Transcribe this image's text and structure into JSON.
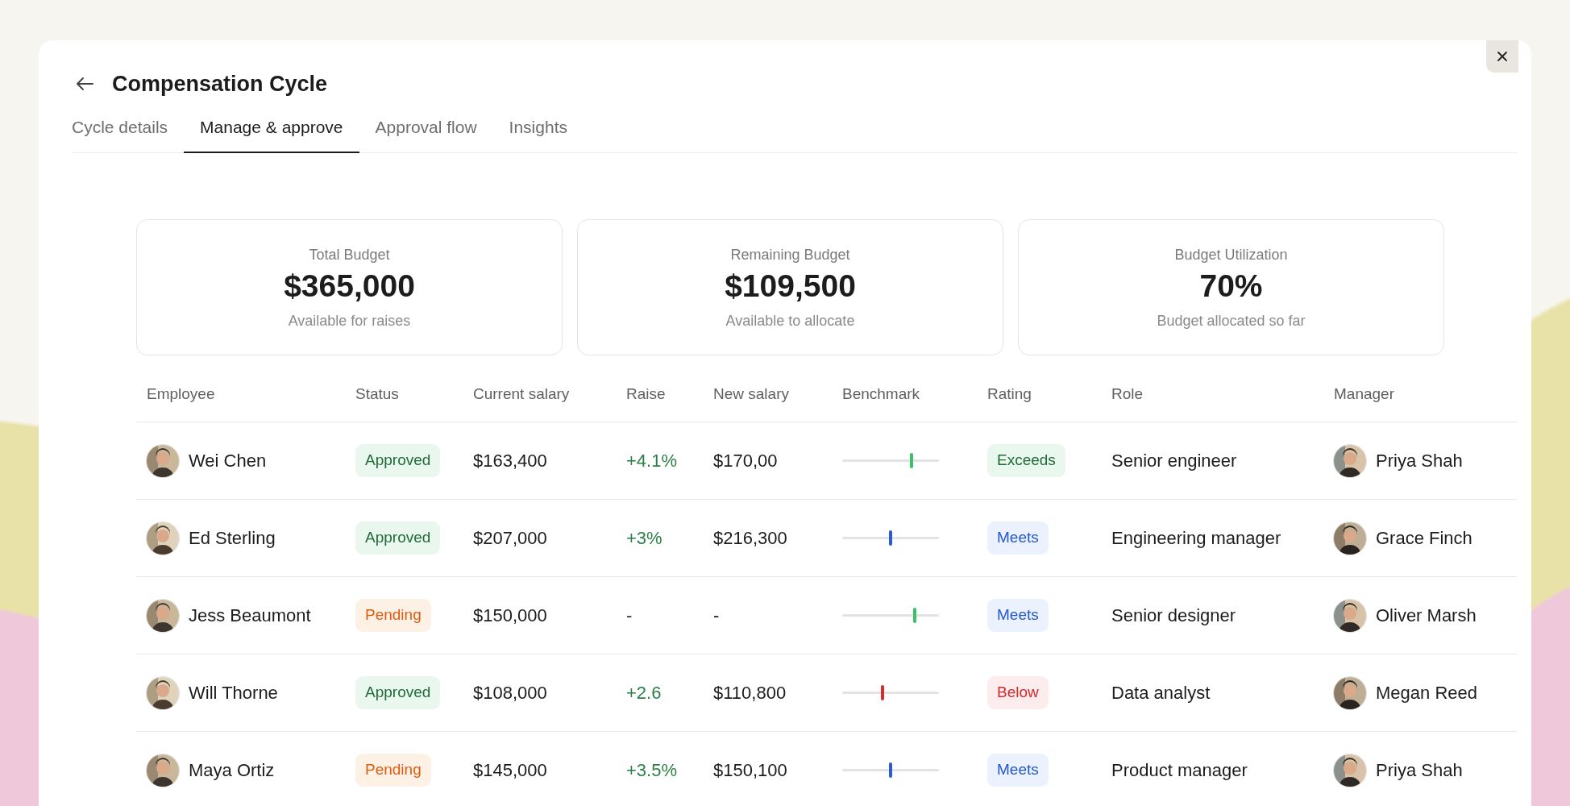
{
  "dialog": {
    "title": "Compensation Cycle"
  },
  "tabs": [
    {
      "label": "Cycle details",
      "selected": false
    },
    {
      "label": "Manage & approve",
      "selected": true
    },
    {
      "label": "Approval flow",
      "selected": false
    },
    {
      "label": "Insights",
      "selected": false
    }
  ],
  "summary_cards": [
    {
      "label": "Total Budget",
      "value": "$365,000",
      "caption": "Available for raises"
    },
    {
      "label": "Remaining Budget",
      "value": "$109,500",
      "caption": "Available to allocate"
    },
    {
      "label": "Budget Utilization",
      "value": "70%",
      "caption": "Budget allocated so far"
    }
  ],
  "table": {
    "columns": [
      "Employee",
      "Status",
      "Current salary",
      "Raise",
      "New salary",
      "Benchmark",
      "Rating",
      "Role",
      "Manager"
    ],
    "rows": [
      {
        "employee": "Wei Chen",
        "status": {
          "label": "Approved",
          "kind": "approved"
        },
        "current_salary": "$163,400",
        "raise": {
          "text": "+4.1%",
          "kind": "increase"
        },
        "new_salary": "$170,00",
        "benchmark": {
          "level": 0.72,
          "color": "#3cc06a"
        },
        "rating": {
          "label": "Exceeds",
          "kind": "exceeds"
        },
        "role": "Senior engineer",
        "manager": "Priya Shah"
      },
      {
        "employee": "Ed Sterling",
        "status": {
          "label": "Approved",
          "kind": "approved"
        },
        "current_salary": "$207,000",
        "raise": {
          "text": "+3%",
          "kind": "increase"
        },
        "new_salary": "$216,300",
        "benchmark": {
          "level": 0.5,
          "color": "#2a5bd7"
        },
        "rating": {
          "label": "Meets",
          "kind": "meets"
        },
        "role": "Engineering manager",
        "manager": "Grace Finch"
      },
      {
        "employee": "Jess Beaumont",
        "status": {
          "label": "Pending",
          "kind": "pending"
        },
        "current_salary": "$150,000",
        "raise": {
          "text": "-",
          "kind": "none"
        },
        "new_salary": "-",
        "benchmark": {
          "level": 0.75,
          "color": "#3cc06a"
        },
        "rating": {
          "label": "Meets",
          "kind": "meets"
        },
        "role": "Senior designer",
        "manager": "Oliver Marsh"
      },
      {
        "employee": "Will Thorne",
        "status": {
          "label": "Approved",
          "kind": "approved"
        },
        "current_salary": "$108,000",
        "raise": {
          "text": "+2.6",
          "kind": "increase"
        },
        "new_salary": "$110,800",
        "benchmark": {
          "level": 0.42,
          "color": "#d92d2d"
        },
        "rating": {
          "label": "Below",
          "kind": "below"
        },
        "role": "Data analyst",
        "manager": "Megan Reed"
      },
      {
        "employee": "Maya Ortiz",
        "status": {
          "label": "Pending",
          "kind": "pending"
        },
        "current_salary": "$145,000",
        "raise": {
          "text": "+3.5%",
          "kind": "increase"
        },
        "new_salary": "$150,100",
        "benchmark": {
          "level": 0.5,
          "color": "#2a5bd7"
        },
        "rating": {
          "label": "Meets",
          "kind": "meets"
        },
        "role": "Product manager",
        "manager": "Priya Shah"
      }
    ]
  }
}
